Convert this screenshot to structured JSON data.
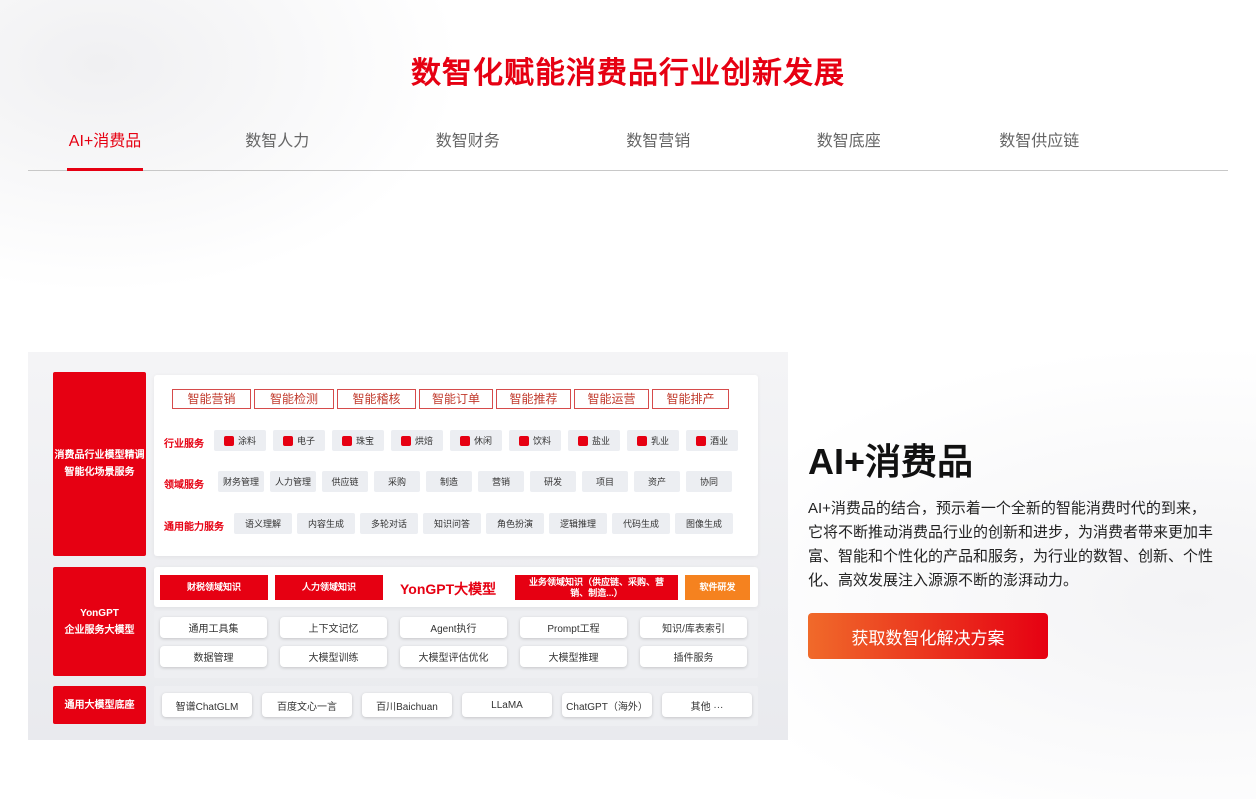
{
  "title": "数智化赋能消费品行业创新发展",
  "tabs": [
    {
      "label": "AI+消费品"
    },
    {
      "label": "数智人力"
    },
    {
      "label": "数智财务"
    },
    {
      "label": "数智营销"
    },
    {
      "label": "数智底座"
    },
    {
      "label": "数智供应链"
    }
  ],
  "active_tab": "AI+消费品",
  "diagram": {
    "left_labels": {
      "scenario": "消费品行业模型精调\n智能化场景服务",
      "yongpt": "YonGPT\n企业服务大模型",
      "base": "通用大模型底座"
    },
    "top_tags": [
      "智能营销",
      "智能检测",
      "智能稽核",
      "智能订单",
      "智能推荐",
      "智能运营",
      "智能排产"
    ],
    "industry": {
      "label": "行业服务",
      "items": [
        "涂料",
        "电子",
        "珠宝",
        "烘焙",
        "休闲",
        "饮料",
        "盐业",
        "乳业",
        "酒业"
      ]
    },
    "domain": {
      "label": "领域服务",
      "items": [
        "财务管理",
        "人力管理",
        "供应链",
        "采购",
        "制造",
        "营销",
        "研发",
        "项目",
        "资产",
        "协同"
      ]
    },
    "general": {
      "label": "通用能力服务",
      "items": [
        "语义理解",
        "内容生成",
        "多轮对话",
        "知识问答",
        "角色扮演",
        "逻辑推理",
        "代码生成",
        "图像生成"
      ]
    },
    "yongpt_row": {
      "left1": "财税领域知识",
      "left2": "人力领域知识",
      "center": "YonGPT大模型",
      "right1": "业务领域知识（供应链、采购、营销、制造...）",
      "right2": "软件研发"
    },
    "tools_row1": [
      "通用工具集",
      "上下文记忆",
      "Agent执行",
      "Prompt工程",
      "知识/库表索引"
    ],
    "tools_row2": [
      "数据管理",
      "大模型训练",
      "大模型评估优化",
      "大模型推理",
      "插件服务"
    ],
    "base_models": [
      "智谱ChatGLM",
      "百度文心一言",
      "百川Baichuan",
      "LLaMA",
      "ChatGPT（海外）",
      "其他 ···"
    ]
  },
  "info": {
    "heading": "AI+消费品",
    "description": "AI+消费品的结合，预示着一个全新的智能消费时代的到来，它将不断推动消费品行业的创新和进步，为消费者带来更加丰富、智能和个性化的产品和服务，为行业的数智、创新、个性化、高效发展注入源源不断的澎湃动力。",
    "cta_label": "获取数智化解决方案"
  },
  "colors": {
    "brand_red": "#e60012",
    "orange": "#f5821f"
  }
}
